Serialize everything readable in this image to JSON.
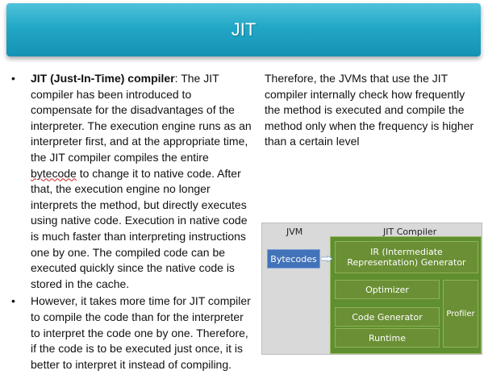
{
  "slide": {
    "title": "JIT"
  },
  "left_column": {
    "bullets": [
      {
        "marker": "•",
        "bold": "JIT (Just-In-Time) compiler",
        "text_a": ": The JIT compiler has been introduced to compensate for the disadvantages of the interpreter. The execution engine runs as an interpreter first, and at the appropriate time, the JIT compiler compiles the entire ",
        "squiggle": "bytecode",
        "text_b": " to change it to native code. After that, the execution engine no longer interprets the method, but directly executes using native code. Execution in native code is much faster than interpreting instructions one by one. The compiled code can be executed quickly since the native code is stored in the cache."
      },
      {
        "marker": "•",
        "text": "However, it takes more time for JIT compiler to compile the code than for the interpreter to interpret the code one by one. Therefore, if the code is to be executed just once, it is better to interpret it instead of compiling."
      }
    ]
  },
  "right_column": {
    "text": "Therefore, the JVMs that use the JIT compiler internally check how frequently the method is executed and compile the method only when the frequency is higher than a certain level"
  },
  "diagram": {
    "jvm_label": "JVM",
    "jit_label": "JIT Compiler",
    "bytecodes": "Bytecodes",
    "ir_generator": "IR (Intermediate Representation) Generator",
    "optimizer": "Optimizer",
    "code_generator": "Code Generator",
    "runtime": "Runtime",
    "profiler": "Profiler"
  },
  "colors": {
    "title_bar": "#22a7c6",
    "diagram_blue": "#4272b8",
    "diagram_green": "#6a8f34"
  }
}
